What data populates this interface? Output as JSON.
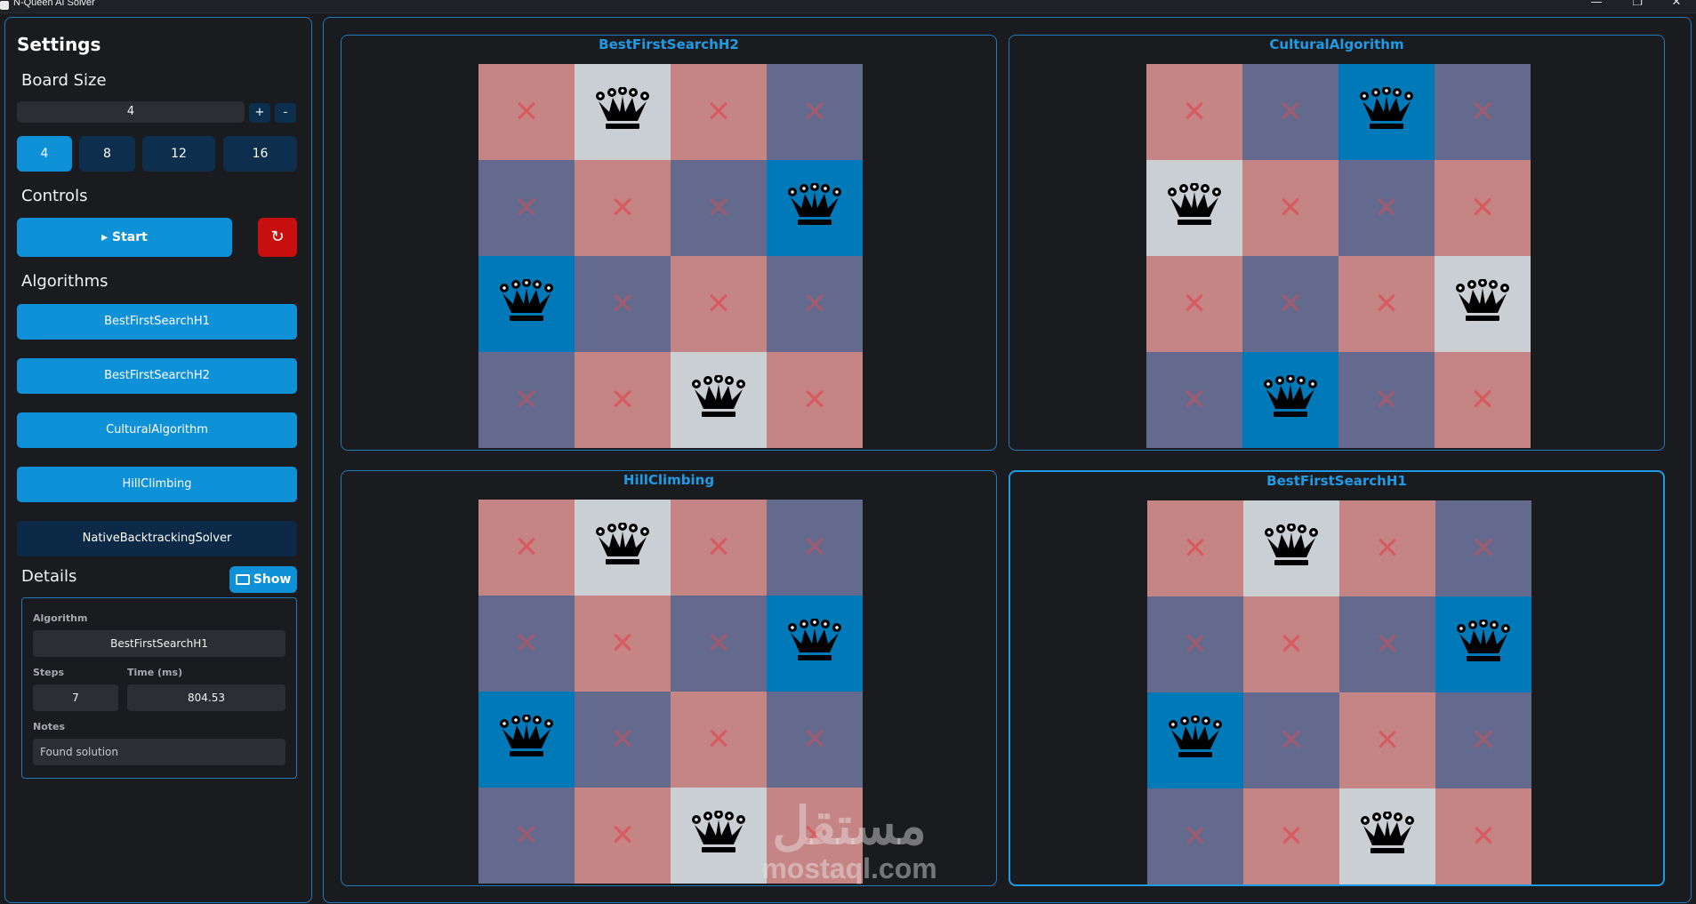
{
  "window": {
    "title": "N-Queen AI Solver",
    "controls": [
      "—",
      "❐",
      "✕"
    ]
  },
  "sidebar": {
    "title": "Settings",
    "board_size": {
      "label": "Board Size",
      "value": "4",
      "increment": "+",
      "decrement": "-",
      "presets": [
        "4",
        "8",
        "12",
        "16"
      ]
    },
    "controls": {
      "label": "Controls",
      "start": "▸ Start",
      "reset": "↻"
    },
    "algorithms": {
      "label": "Algorithms",
      "items": [
        "BestFirstSearchH1",
        "BestFirstSearchH2",
        "CulturalAlgorithm",
        "HillClimbing",
        "NativeBacktrackingSolver"
      ]
    },
    "details": {
      "label": "Details",
      "show_button": "Show",
      "algorithm_label": "Algorithm",
      "algorithm_value": "BestFirstSearchH1",
      "steps_label": "Steps",
      "steps_value": "7",
      "time_label": "Time (ms)",
      "time_value": "804.53",
      "notes_label": "Notes",
      "notes_value": "Found solution"
    }
  },
  "boards": [
    {
      "title": "BestFirstSearchH2",
      "queens": [
        1,
        3,
        0,
        2
      ]
    },
    {
      "title": "CulturalAlgorithm",
      "queens": [
        2,
        0,
        3,
        1
      ]
    },
    {
      "title": "HillClimbing",
      "queens": [
        1,
        3,
        0,
        2
      ]
    },
    {
      "title": "BestFirstSearchH1",
      "queens": [
        1,
        3,
        0,
        2
      ]
    }
  ],
  "colors": {
    "accent": "#0f91d8",
    "panel_border": "#1f7ab8",
    "light_square": "#c68585",
    "dark_square": "#636a8e",
    "queen_on_light": "#c9cfd3",
    "queen_on_dark": "#0079b8",
    "reset": "#c80f0f"
  },
  "watermark": {
    "arabic": "مستقل",
    "latin": "mostaql.com"
  }
}
